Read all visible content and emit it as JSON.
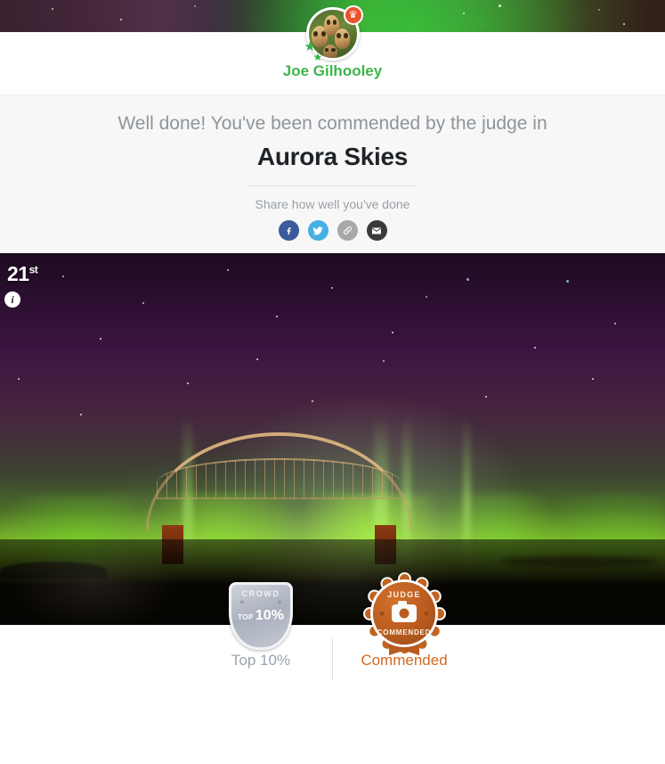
{
  "cover": {
    "name": "aurora-cover-photo"
  },
  "profile": {
    "name": "Joe Gilhooley",
    "avatar_alt": "owls-avatar",
    "crown_badge": "crown-icon",
    "star_decoration": "star-icon"
  },
  "message": {
    "congrats": "Well done! You've been commended by the judge in",
    "contest_title": "Aurora Skies",
    "share_label": "Share how well you've done"
  },
  "share": {
    "buttons": [
      {
        "name": "facebook",
        "label": "f",
        "color": "#3b5a9b"
      },
      {
        "name": "twitter",
        "label": "t",
        "color": "#45b0e3"
      },
      {
        "name": "link",
        "label": "link",
        "color": "#a8a8a8"
      },
      {
        "name": "email",
        "label": "email",
        "color": "#3a3a3a"
      }
    ]
  },
  "photo": {
    "rank_number": "21",
    "rank_suffix": "st",
    "info_icon": "i",
    "alt": "aurora-borealis-over-belhaven-bridge"
  },
  "awards": [
    {
      "badge_type": "crowd-shield",
      "badge_top_text": "CROWD",
      "badge_pre_text": "TOP",
      "badge_value_text": "10%",
      "label": "Top 10%",
      "color": "#9aa3b0"
    },
    {
      "badge_type": "judge-rosette",
      "badge_top_text": "JUDGE",
      "badge_bottom_text": "COMMENDED",
      "label": "Commended",
      "color": "#d2691e"
    }
  ]
}
